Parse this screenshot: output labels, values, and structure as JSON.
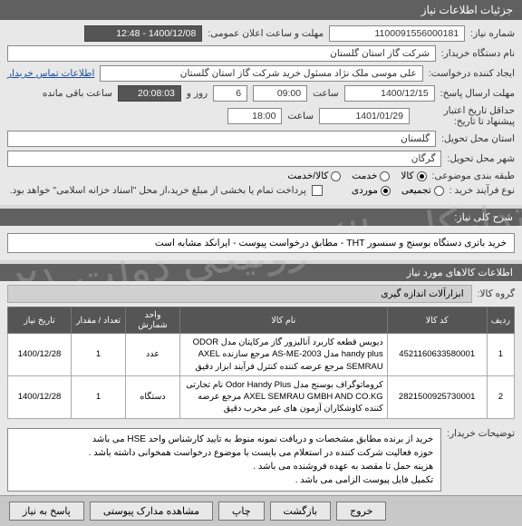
{
  "header": {
    "title": "جزئیات اطلاعات نیاز"
  },
  "fields": {
    "need_no_label": "شماره نیاز:",
    "need_no": "1100091556000181",
    "announce_label": "مهلت و ساعت اعلان عمومی:",
    "announce_value": "1400/12/08 - 12:48",
    "buyer_org_label": "نام دستگاه خریدار:",
    "buyer_org": "شرکت گاز استان گلستان",
    "requester_label": "ایجاد کننده درخواست:",
    "requester": "علی موسی ملک نژاد مسئول خرید شرکت گاز استان گلستان",
    "contact_link": "اطلاعات تماس خریدار",
    "deadline_label": "حداقل تاریخ اعتبار پیشنهاد تا تاریخ:",
    "deadline_date": "1400/12/15",
    "time_label": "ساعت",
    "deadline_time": "09:00",
    "day_label": "روز و",
    "days": "6",
    "remain_label": "ساعت باقی مانده",
    "remain_time": "20:08:03",
    "send_deadline_label": "مهلت ارسال پاسخ:",
    "price_date": "1401/01/29",
    "price_time": "18:00",
    "province_label": "استان محل تحویل:",
    "province": "گلستان",
    "city_label": "شهر محل تحویل:",
    "city": "گرگان",
    "class_label": "طبقه بندی موضوعی:",
    "class_options": [
      "کالا",
      "خدمت",
      "کالا/خدمت"
    ],
    "buy_type_label": "نوع فرآیند خرید :",
    "buy_types": [
      "تجمیعی",
      "موردی"
    ],
    "checkbox_text": "پرداخت تمام یا بخشی از مبلغ خرید،از محل \"اسناد خزانه اسلامی\" خواهد بود.",
    "need_title_label": "شرح کلی نیاز:",
    "need_title": "خرید باتری دستگاه بوسنج و سنسور THT  - مطابق درخواست پیوست - ایرانکد مشابه است",
    "items_heading": "اطلاعات کالاهای مورد نیاز",
    "group_label": "گروه کالا:",
    "group_value": "ابزارآلات اندازه گیری"
  },
  "table": {
    "headers": [
      "ردیف",
      "کد کالا",
      "نام کالا",
      "واحد شمارش",
      "تعداد / مقدار",
      "تاریخ نیاز"
    ],
    "rows": [
      {
        "idx": "1",
        "code": "4521160633580001",
        "name": "دیویس قطعه کاربرد آنالیزور گاز مرکاپتان مدل ODOR handy plus مدل AS-ME-2003 مرجع سازنده AXEL SEMRAU مرجع عرضه کننده کنترل فرآیند ابزار دقیق",
        "unit": "عدد",
        "qty": "1",
        "date": "1400/12/28"
      },
      {
        "idx": "2",
        "code": "2821500925730001",
        "name": "کروماتوگراف بوسنج مدل Odor Handy Plus نام تجارتی AXEL SEMRAU GMBH AND CO.KG مرجع عرضه کننده کاوشکاران آزمون های غیر مخرب دقیق",
        "unit": "دستگاه",
        "qty": "1",
        "date": "1400/12/28"
      }
    ]
  },
  "notes": {
    "label": "توضیحات خریدار:",
    "text": "خرید از برنده مطابق مشخصات و دریافت نمونه منوط به تایید کارشناس واحد HSE می باشد\nحوزه فعالیت شرکت کننده در استعلام می بایست با موضوع درخواست همخوانی داشته باشد .\nهزینه حمل تا مقصد به عهده فروشنده می باشد .\nتکمیل فایل پیوست  الزامی می باشد ."
  },
  "footer": {
    "respond": "پاسخ به نیاز",
    "docs": "مشاهده مدارک پیوستی",
    "print": "چاپ",
    "back": "بازگشت",
    "exit": "خروج"
  },
  "watermark": "سامانه تدارکات الکترونیکی دولت\n۰۲۱-۴۱۹۳۴"
}
